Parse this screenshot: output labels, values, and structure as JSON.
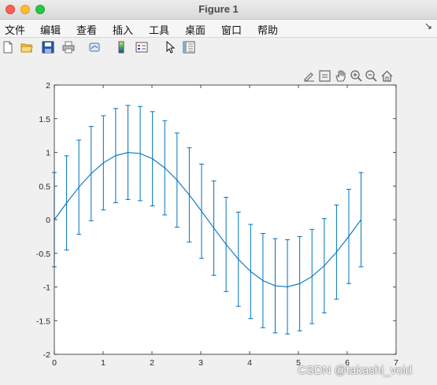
{
  "window": {
    "title": "Figure 1"
  },
  "menu": {
    "items": [
      "文件",
      "编辑",
      "查看",
      "插入",
      "工具",
      "桌面",
      "窗口",
      "帮助"
    ],
    "overflow_icon": "arrow-icon"
  },
  "toolbar": {
    "buttons": [
      "new-figure-icon",
      "open-file-icon",
      "save-icon",
      "print-icon",
      "link-plot-icon",
      "insert-colorbar-icon",
      "insert-legend-icon",
      "edit-plot-cursor-icon",
      "property-inspector-icon"
    ]
  },
  "axes_toolbar": {
    "buttons": [
      "brush-icon",
      "data-tips-icon",
      "pan-hand-icon",
      "zoom-in-icon",
      "zoom-out-icon",
      "restore-view-home-icon"
    ]
  },
  "chart_data": {
    "type": "line",
    "series": [
      {
        "x": [
          0,
          0.2513,
          0.5027,
          0.754,
          1.0053,
          1.2566,
          1.508,
          1.7593,
          2.0106,
          2.2619,
          2.5133,
          2.7646,
          3.0159,
          3.2673,
          3.5186,
          3.7699,
          4.0212,
          4.2726,
          4.5239,
          4.7752,
          5.0265,
          5.2779,
          5.5292,
          5.7805,
          6.0319,
          6.2832
        ],
        "y": [
          0,
          0.2487,
          0.4818,
          0.6845,
          0.8443,
          0.9511,
          0.998,
          0.9823,
          0.9048,
          0.7705,
          0.5878,
          0.3681,
          0.1253,
          -0.1253,
          -0.3681,
          -0.5878,
          -0.7705,
          -0.9048,
          -0.9823,
          -0.998,
          -0.9511,
          -0.8443,
          -0.6845,
          -0.4818,
          -0.2487,
          0
        ],
        "error": [
          0.7,
          0.7,
          0.7,
          0.7,
          0.7,
          0.7,
          0.7,
          0.7,
          0.7,
          0.7,
          0.7,
          0.7,
          0.7,
          0.7,
          0.7,
          0.7,
          0.7,
          0.7,
          0.7,
          0.7,
          0.7,
          0.7,
          0.7,
          0.7,
          0.7,
          0.7
        ],
        "color": "#0072bd"
      }
    ],
    "xlim": [
      0,
      7
    ],
    "ylim": [
      -2,
      2
    ],
    "xticks": [
      "0",
      "1",
      "2",
      "3",
      "4",
      "5",
      "6",
      "7"
    ],
    "yticks": [
      "-2",
      "-1.5",
      "-1",
      "-0.5",
      "0",
      "0.5",
      "1",
      "1.5",
      "2"
    ],
    "grid": false
  },
  "watermark": "CSDN @takashi_void"
}
